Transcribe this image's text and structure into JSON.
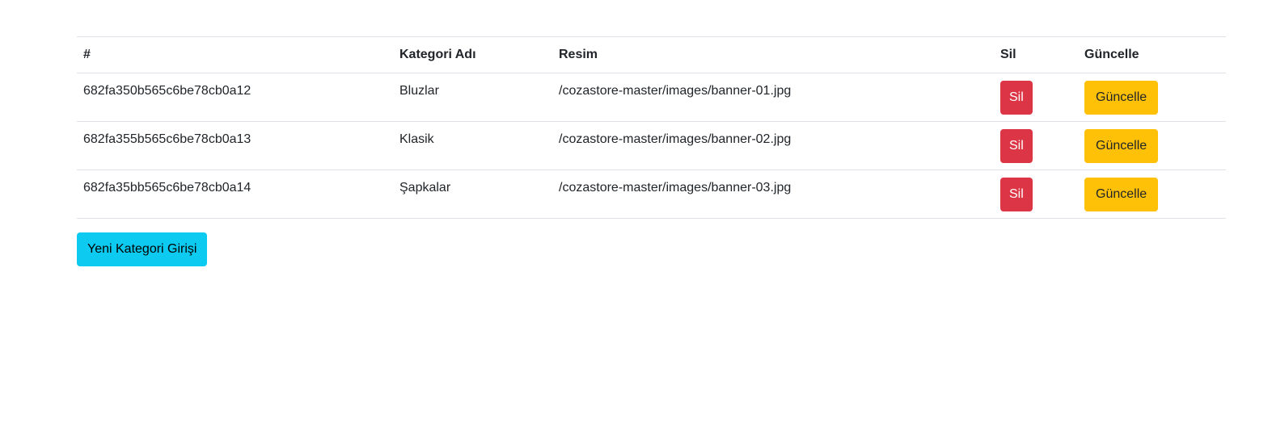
{
  "table": {
    "headers": {
      "id": "#",
      "name": "Kategori Adı",
      "image": "Resim",
      "delete": "Sil",
      "update": "Güncelle"
    },
    "rows": [
      {
        "id": "682fa350b565c6be78cb0a12",
        "name": "Bluzlar",
        "image": "/cozastore-master/images/banner-01.jpg",
        "delete_label": "Sil",
        "update_label": "Güncelle"
      },
      {
        "id": "682fa355b565c6be78cb0a13",
        "name": "Klasik",
        "image": "/cozastore-master/images/banner-02.jpg",
        "delete_label": "Sil",
        "update_label": "Güncelle"
      },
      {
        "id": "682fa35bb565c6be78cb0a14",
        "name": "Şapkalar",
        "image": "/cozastore-master/images/banner-03.jpg",
        "delete_label": "Sil",
        "update_label": "Güncelle"
      }
    ]
  },
  "new_category_label": "Yeni Kategori Girişi",
  "colors": {
    "danger": "#dc3545",
    "warning": "#ffc107",
    "info": "#0dcaf0",
    "border": "#dee2e6"
  }
}
